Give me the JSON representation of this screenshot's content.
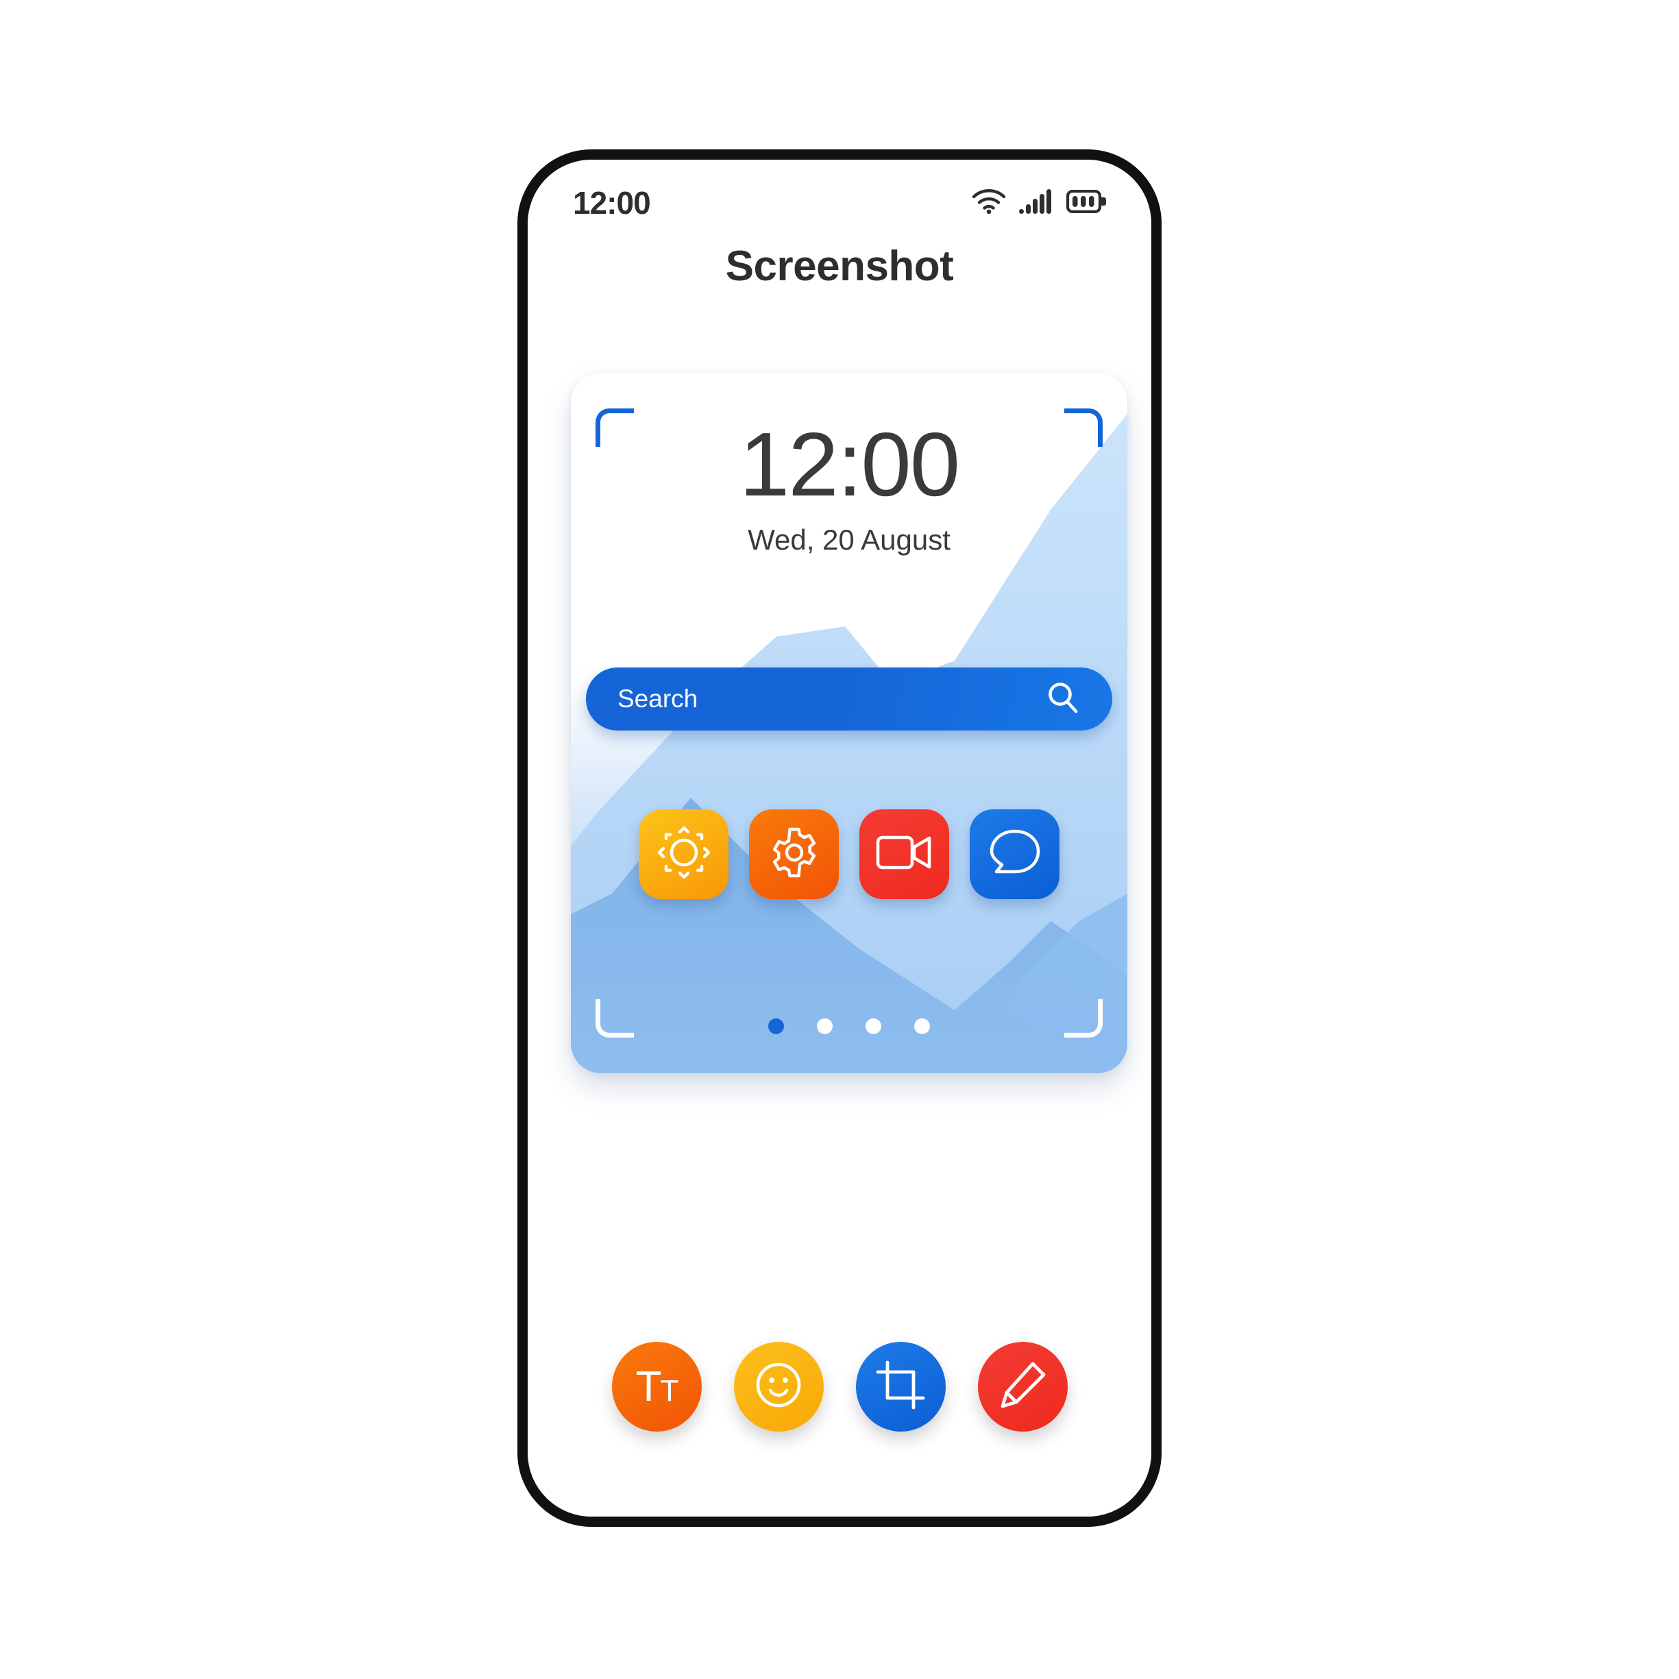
{
  "status_bar": {
    "time": "12:00",
    "icons": [
      "wifi-icon",
      "cellular-signal-icon",
      "battery-icon"
    ],
    "signal_bars": 5,
    "battery_segments": 3
  },
  "header": {
    "title": "Screenshot"
  },
  "preview": {
    "lock_screen": {
      "clock": "12:00",
      "date": "Wed, 20 August"
    },
    "search": {
      "placeholder": "Search",
      "icon": "search-icon"
    },
    "app_icons": [
      {
        "name": "weather",
        "icon": "sun-icon",
        "color_from": "#fcc419",
        "color_to": "#f99705"
      },
      {
        "name": "settings",
        "icon": "gear-icon",
        "color_from": "#f97a0b",
        "color_to": "#f25406"
      },
      {
        "name": "video",
        "icon": "video-camera-icon",
        "color_from": "#f43c34",
        "color_to": "#ef2b1f"
      },
      {
        "name": "messages",
        "icon": "chat-bubble-icon",
        "color_from": "#1f7ae8",
        "color_to": "#0a5fd4"
      }
    ],
    "page_dots": {
      "count": 4,
      "active_index": 0,
      "active_color": "#1565d8",
      "inactive_color": "#ffffff"
    },
    "brackets": {
      "top_color": "#1565d8",
      "bottom_color": "#ffffff"
    },
    "wallpaper": {
      "back_mountain_color": "#c9e3fa",
      "front_mountain_color": "#7fb2e8",
      "sky_color": "#ffffff",
      "base_color": "#8dbcee"
    }
  },
  "toolbar": {
    "buttons": [
      {
        "name": "text",
        "icon": "text-format-icon",
        "label_main": "T",
        "label_sub": "T",
        "color_from": "#f97a0b",
        "color_to": "#f25406"
      },
      {
        "name": "sticker",
        "icon": "smiley-face-icon",
        "color_from": "#fcc01c",
        "color_to": "#f9a806"
      },
      {
        "name": "crop",
        "icon": "crop-icon",
        "color_from": "#1f7ae8",
        "color_to": "#0a5fd4"
      },
      {
        "name": "draw",
        "icon": "pencil-icon",
        "color_from": "#f43c34",
        "color_to": "#ee2a1d"
      }
    ]
  },
  "colors": {
    "frame": "#111111",
    "text_dark": "#2e2e2e",
    "accent_blue": "#1565d8",
    "card_background": "#ffffff"
  }
}
